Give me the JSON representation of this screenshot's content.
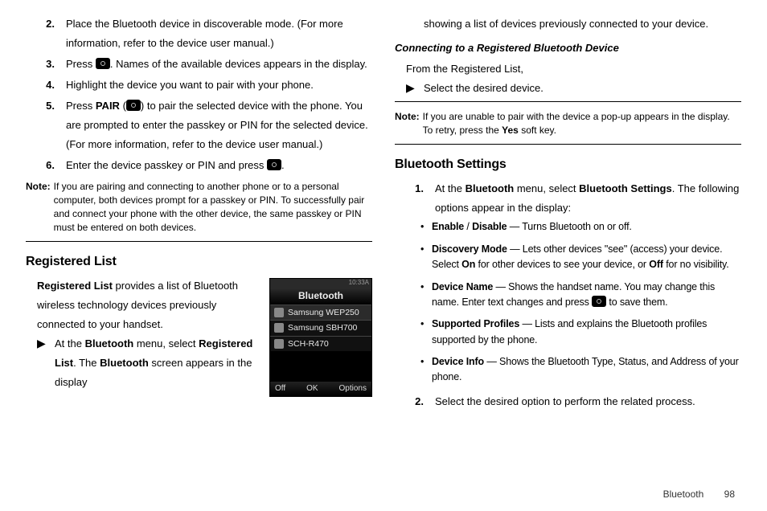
{
  "left": {
    "steps": [
      {
        "n": "2.",
        "t": "Place the Bluetooth device in discoverable mode. (For more information, refer to the device user manual.)"
      },
      {
        "n": "3.",
        "pre": "Press ",
        "post": ". Names of the available devices appears in the display."
      },
      {
        "n": "4.",
        "t": "Highlight the device you want to pair with your phone."
      },
      {
        "n": "5.",
        "pre": "Press ",
        "bold1": "PAIR",
        "mid": " (",
        "post": ") to pair the selected device with the phone. You are prompted to enter the passkey or PIN for the selected device. (For more information, refer to the device user manual.)"
      },
      {
        "n": "6.",
        "pre": "Enter the device passkey or PIN and press ",
        "post": "."
      }
    ],
    "note_label": "Note:",
    "note": "If you are pairing and connecting to another phone or to a personal computer, both devices prompt for a passkey or PIN. To successfully pair and connect your phone with the other device, the same passkey or PIN must be entered on both devices.",
    "h2": "Registered List",
    "para_b": "Registered List",
    "para_rest": " provides a list of Bluetooth wireless technology devices previously connected to your handset.",
    "arrow_pre": "At the ",
    "arrow_b1": "Bluetooth",
    "arrow_mid": " menu, select ",
    "arrow_b2": "Registered List",
    "arrow_mid2": ". The ",
    "arrow_b3": "Bluetooth",
    "arrow_post": " screen appears in the display "
  },
  "phone": {
    "time": "10:33A",
    "title": "Bluetooth",
    "rows": [
      "Samsung WEP250",
      "Samsung SBH700",
      "SCH-R470"
    ],
    "soft": [
      "Off",
      "OK",
      "Options"
    ]
  },
  "right": {
    "top": "showing a list of devices previously connected to your device.",
    "h3": "Connecting to a Registered Bluetooth Device",
    "from": "From the Registered List,",
    "select": "Select the desired device.",
    "note_label": "Note:",
    "note_pre": "If you are unable to pair with the device a pop-up appears in the display. To retry, press the ",
    "note_b": "Yes",
    "note_post": " soft key.",
    "h2": "Bluetooth Settings",
    "step1_n": "1.",
    "step1_pre": "At the ",
    "step1_b1": "Bluetooth",
    "step1_mid": " menu, select ",
    "step1_b2": "Bluetooth Settings",
    "step1_post": ". The following options appear in the display:",
    "bullets": [
      {
        "b": "Enable",
        "sep": " / ",
        "b2": "Disable",
        "t": " — Turns Bluetooth on or off."
      },
      {
        "b": "Discovery Mode",
        "t": " — Lets other devices \"see\" (access) your device. Select ",
        "b2": "On",
        "t2": " for other devices to see your device, or ",
        "b3": "Off",
        "t3": " for no visibility."
      },
      {
        "b": "Device Name",
        "t": " — Shows the handset name. You may change this name. Enter text changes and press ",
        "icon": true,
        "t2": " to save them."
      },
      {
        "b": "Supported Profiles",
        "t": " — Lists and explains the Bluetooth profiles supported by the phone."
      },
      {
        "b": "Device Info",
        "t": " — Shows the Bluetooth Type, Status, and Address of your phone."
      }
    ],
    "step2_n": "2.",
    "step2": "Select the desired option to perform the related process."
  },
  "footer": {
    "section": "Bluetooth",
    "page": "98"
  }
}
